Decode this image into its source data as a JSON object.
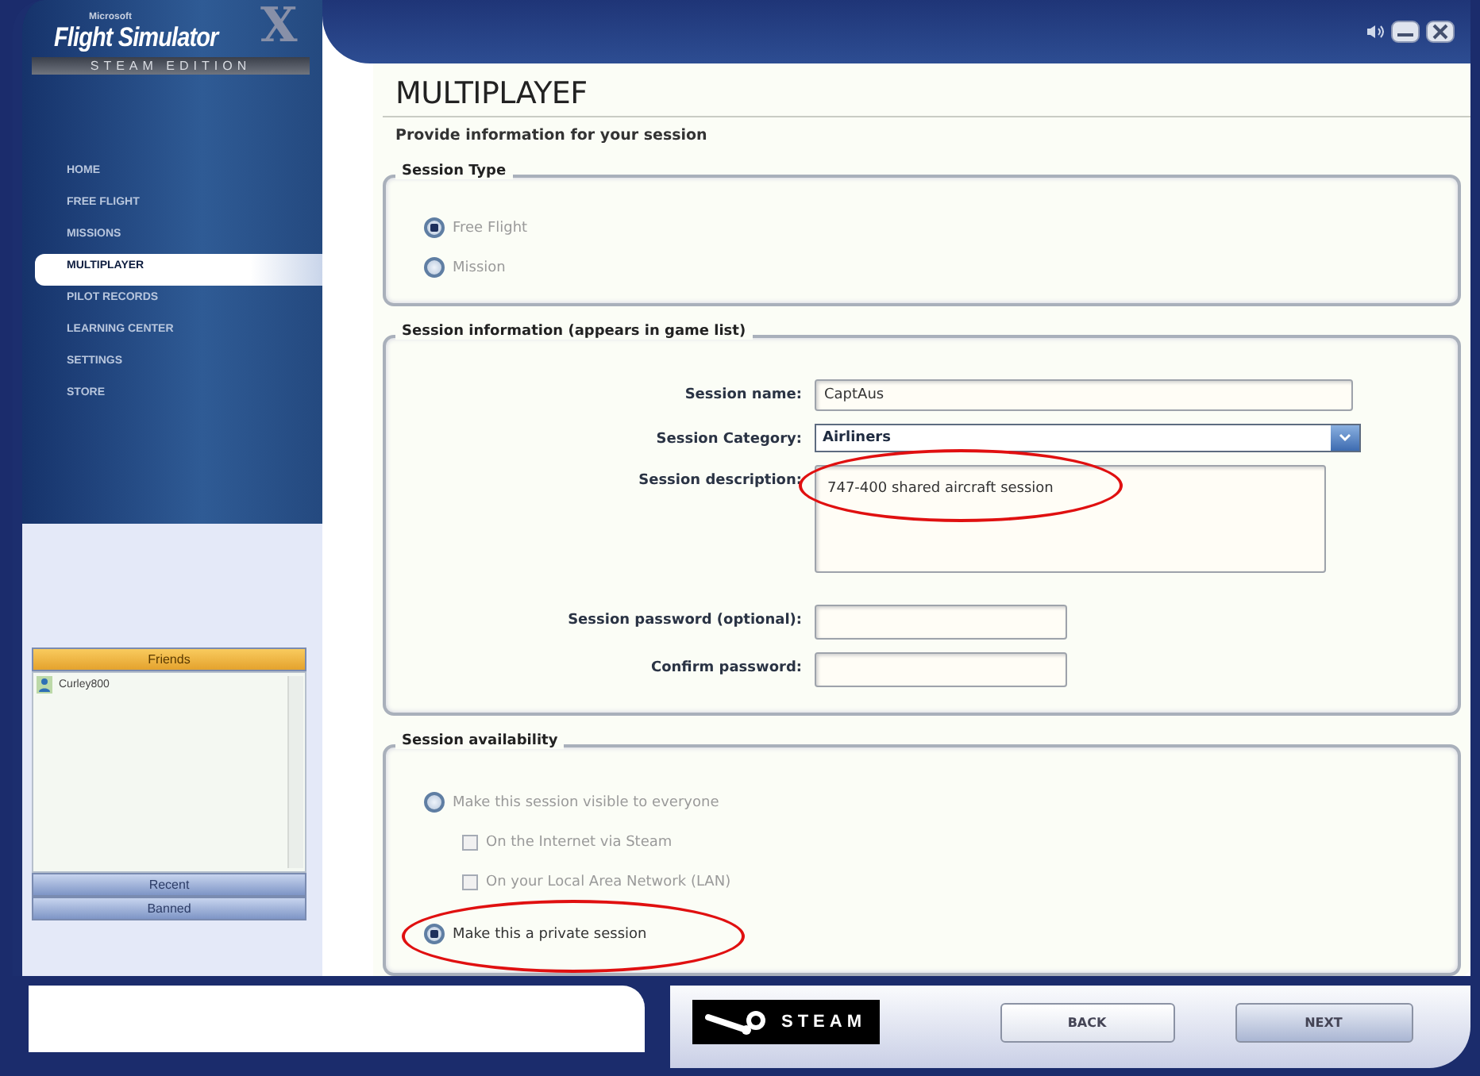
{
  "logo": {
    "brand": "Microsoft",
    "title": "Flight Simulator",
    "mark": "X",
    "edition": "STEAM EDITION"
  },
  "nav": [
    {
      "label": "HOME",
      "selected": false
    },
    {
      "label": "FREE FLIGHT",
      "selected": false
    },
    {
      "label": "MISSIONS",
      "selected": false
    },
    {
      "label": "MULTIPLAYER",
      "selected": true
    },
    {
      "label": "PILOT RECORDS",
      "selected": false
    },
    {
      "label": "LEARNING CENTER",
      "selected": false
    },
    {
      "label": "SETTINGS",
      "selected": false
    },
    {
      "label": "STORE",
      "selected": false
    }
  ],
  "friends_panel": {
    "tabs": [
      {
        "label": "Friends",
        "selected": true
      }
    ],
    "friends": [
      "Curley800"
    ],
    "bottom_tabs": [
      {
        "label": "Recent",
        "selected": false
      },
      {
        "label": "Banned",
        "selected": false
      }
    ]
  },
  "page": {
    "title": "MULTIPLAYEF",
    "subtitle": "Provide information for your session"
  },
  "session_type": {
    "legend": "Session Type",
    "options": [
      {
        "label": "Free Flight",
        "selected": true,
        "disabled": true
      },
      {
        "label": "Mission",
        "selected": false,
        "disabled": true
      }
    ]
  },
  "session_info": {
    "legend": "Session information (appears in game list)",
    "fields": [
      {
        "kind": "text",
        "label": "Session name:",
        "value": "CaptAus"
      },
      {
        "kind": "dropdown",
        "label": "Session Category:",
        "value": "Airliners"
      },
      {
        "kind": "textarea",
        "label": "Session description:",
        "value": "747-400 shared aircraft session",
        "circled": true
      },
      {
        "kind": "password",
        "label": "Session password (optional):"
      },
      {
        "kind": "password",
        "label": "Confirm password:"
      }
    ]
  },
  "session_availability": {
    "legend": "Session availability",
    "options": [
      {
        "kind": "radio",
        "label": "Make this session visible to everyone",
        "selected": false,
        "disabled": true
      },
      {
        "kind": "checkbox",
        "label": "On the Internet via Steam",
        "checked": false,
        "disabled": true
      },
      {
        "kind": "checkbox",
        "label": "On your Local Area Network (LAN)",
        "checked": false,
        "disabled": true
      },
      {
        "kind": "radio",
        "label": "Make this a private session",
        "selected": true,
        "disabled": false,
        "circled": true
      }
    ]
  },
  "footer": {
    "steam_label": "STEAM",
    "buttons": [
      "BACK",
      "NEXT"
    ]
  }
}
